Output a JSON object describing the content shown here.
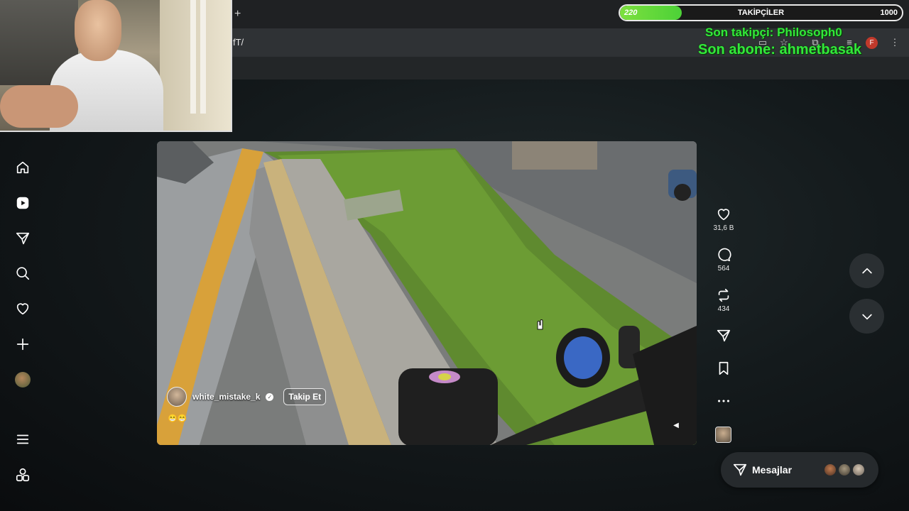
{
  "browser": {
    "url_fragment": "fT/",
    "profile_initial": "F",
    "new_tab_label": "+"
  },
  "overlay": {
    "followers_title": "TAKİPÇİLER",
    "followers_current": "220",
    "followers_goal": "1000",
    "followers_progress": 0.22,
    "last_follower": "Son takipçi: Philosoph0",
    "last_subscriber": "Son abone: ahmetbasak"
  },
  "nav": {
    "items": [
      "home-icon",
      "reels-icon",
      "messages-icon",
      "search-icon",
      "heart-icon",
      "create-icon",
      "profile-avatar",
      "more-menu-icon",
      "also-from-meta-icon"
    ]
  },
  "post": {
    "username": "white_mistake_k",
    "follow_label": "Takip Et",
    "caption": "😁😁",
    "likes": "31,6 B",
    "comments": "564",
    "reposts": "434"
  },
  "messages": {
    "label": "Mesajlar"
  },
  "colors": {
    "overlay_green": "#33e83a",
    "progress_green": "#7de03f",
    "profile_red": "#c0392b",
    "panel_bg": "#262a2d"
  }
}
